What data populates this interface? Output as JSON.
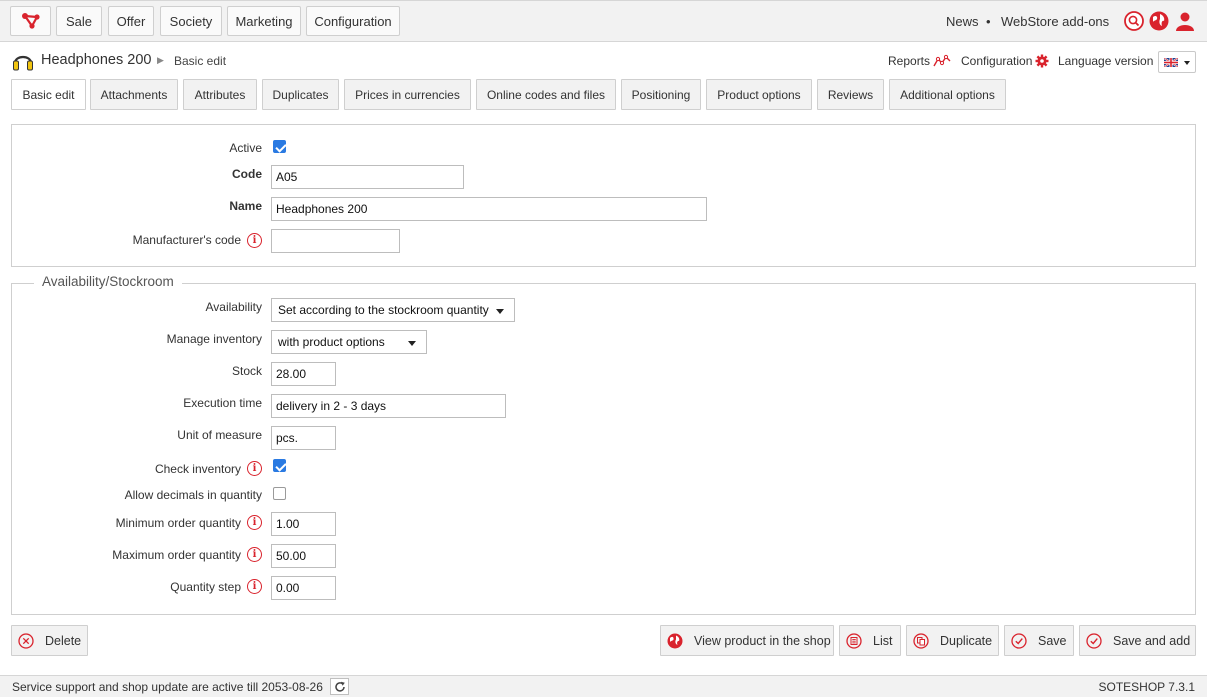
{
  "topnav": {
    "items": [
      "Sale",
      "Offer",
      "Society",
      "Marketing",
      "Configuration"
    ],
    "news": "News",
    "separator": "•",
    "addons": "WebStore add-ons"
  },
  "header": {
    "product_title": "Headphones 200",
    "breadcrumb": "Basic edit",
    "reports": "Reports",
    "configuration": "Configuration",
    "language_version": "Language version"
  },
  "tabs": [
    "Basic edit",
    "Attachments",
    "Attributes",
    "Duplicates",
    "Prices in currencies",
    "Online codes and files",
    "Positioning",
    "Product options",
    "Reviews",
    "Additional options"
  ],
  "basic": {
    "active_label": "Active",
    "active_checked": true,
    "code_label": "Code",
    "code_value": "A05",
    "name_label": "Name",
    "name_value": "Headphones 200",
    "manufacturer_label": "Manufacturer's code",
    "manufacturer_value": ""
  },
  "stock": {
    "legend": "Availability/Stockroom",
    "availability_label": "Availability",
    "availability_value": "Set according to the stockroom quantity",
    "manage_label": "Manage inventory",
    "manage_value": "with product options",
    "stock_label": "Stock",
    "stock_value": "28.00",
    "execution_label": "Execution time",
    "execution_value": "delivery in 2 - 3 days",
    "unit_label": "Unit of measure",
    "unit_value": "pcs.",
    "check_label": "Check inventory",
    "check_checked": true,
    "decimals_label": "Allow decimals in quantity",
    "decimals_checked": false,
    "min_label": "Minimum order quantity",
    "min_value": "1.00",
    "max_label": "Maximum order quantity",
    "max_value": "50.00",
    "step_label": "Quantity step",
    "step_value": "0.00"
  },
  "actions": {
    "delete": "Delete",
    "view": "View product in the shop",
    "list": "List",
    "duplicate": "Duplicate",
    "save": "Save",
    "save_add": "Save and add"
  },
  "footer": {
    "support": "Service support and shop update are active till 2053-08-26",
    "version": "SOTESHOP 7.3.1"
  },
  "colors": {
    "accent": "#d9232d",
    "checkbox": "#2a7ae2"
  }
}
